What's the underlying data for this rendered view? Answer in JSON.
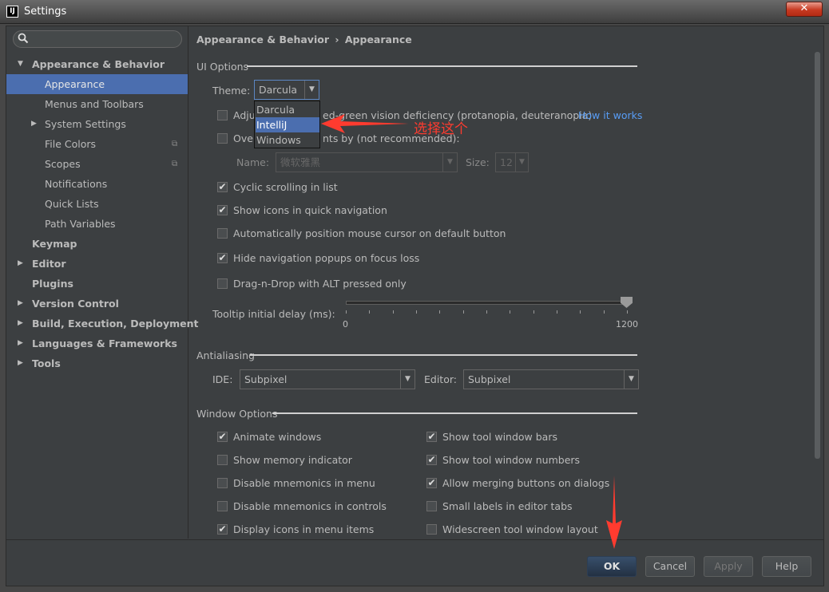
{
  "window": {
    "title": "Settings",
    "app_icon_text": "IJ",
    "close_symbol": "✕"
  },
  "search": {
    "placeholder": "",
    "icon": "search-icon"
  },
  "sidebar": {
    "items": [
      {
        "label": "Appearance & Behavior"
      },
      {
        "label": "Appearance"
      },
      {
        "label": "Menus and Toolbars"
      },
      {
        "label": "System Settings"
      },
      {
        "label": "File Colors"
      },
      {
        "label": "Scopes"
      },
      {
        "label": "Notifications"
      },
      {
        "label": "Quick Lists"
      },
      {
        "label": "Path Variables"
      },
      {
        "label": "Keymap"
      },
      {
        "label": "Editor"
      },
      {
        "label": "Plugins"
      },
      {
        "label": "Version Control"
      },
      {
        "label": "Build, Execution, Deployment"
      },
      {
        "label": "Languages & Frameworks"
      },
      {
        "label": "Tools"
      }
    ]
  },
  "breadcrumb": {
    "parent": "Appearance & Behavior",
    "separator": "›",
    "current": "Appearance"
  },
  "ui_options": {
    "title": "UI Options",
    "theme_label": "Theme:",
    "theme_value": "Darcula",
    "theme_options": [
      "Darcula",
      "IntelliJ",
      "Windows"
    ],
    "adjust_prefix": "Adju",
    "adjust_suffix": "ed-green vision deficiency (protanopia, deuteranopia)",
    "how_it_works": "How it works",
    "override_prefix": "Over",
    "override_suffix": "nts by (not recommended):",
    "name_label": "Name:",
    "name_value": "微软雅黑",
    "size_label": "Size:",
    "size_value": "12",
    "cyclic_scrolling": "Cyclic scrolling in list",
    "show_icons_nav": "Show icons in quick navigation",
    "auto_position_cursor": "Automatically position mouse cursor on default button",
    "hide_nav_popups": "Hide navigation popups on focus loss",
    "drag_n_drop_alt": "Drag-n-Drop with ALT pressed only",
    "tooltip_label": "Tooltip initial delay (ms):",
    "tooltip_min": "0",
    "tooltip_max": "1200",
    "tooltip_value": 1200
  },
  "antialiasing": {
    "title": "Antialiasing",
    "ide_label": "IDE:",
    "ide_value": "Subpixel",
    "editor_label": "Editor:",
    "editor_value": "Subpixel"
  },
  "window_options": {
    "title": "Window Options",
    "animate_windows": "Animate windows",
    "show_memory": "Show memory indicator",
    "disable_mnemonics_menu": "Disable mnemonics in menu",
    "disable_mnemonics_controls": "Disable mnemonics in controls",
    "display_icons_menu": "Display icons in menu items",
    "show_tool_window_bars": "Show tool window bars",
    "show_tool_window_numbers": "Show tool window numbers",
    "allow_merging_buttons": "Allow merging buttons on dialogs",
    "small_labels_tabs": "Small labels in editor tabs",
    "widescreen_layout": "Widescreen tool window layout"
  },
  "buttons": {
    "ok": "OK",
    "cancel": "Cancel",
    "apply": "Apply",
    "help": "Help"
  },
  "annotation": {
    "text": "选择这个"
  },
  "colors": {
    "accent": "#4b6eaf",
    "link": "#589df6",
    "annotation": "#ff3b2f"
  }
}
